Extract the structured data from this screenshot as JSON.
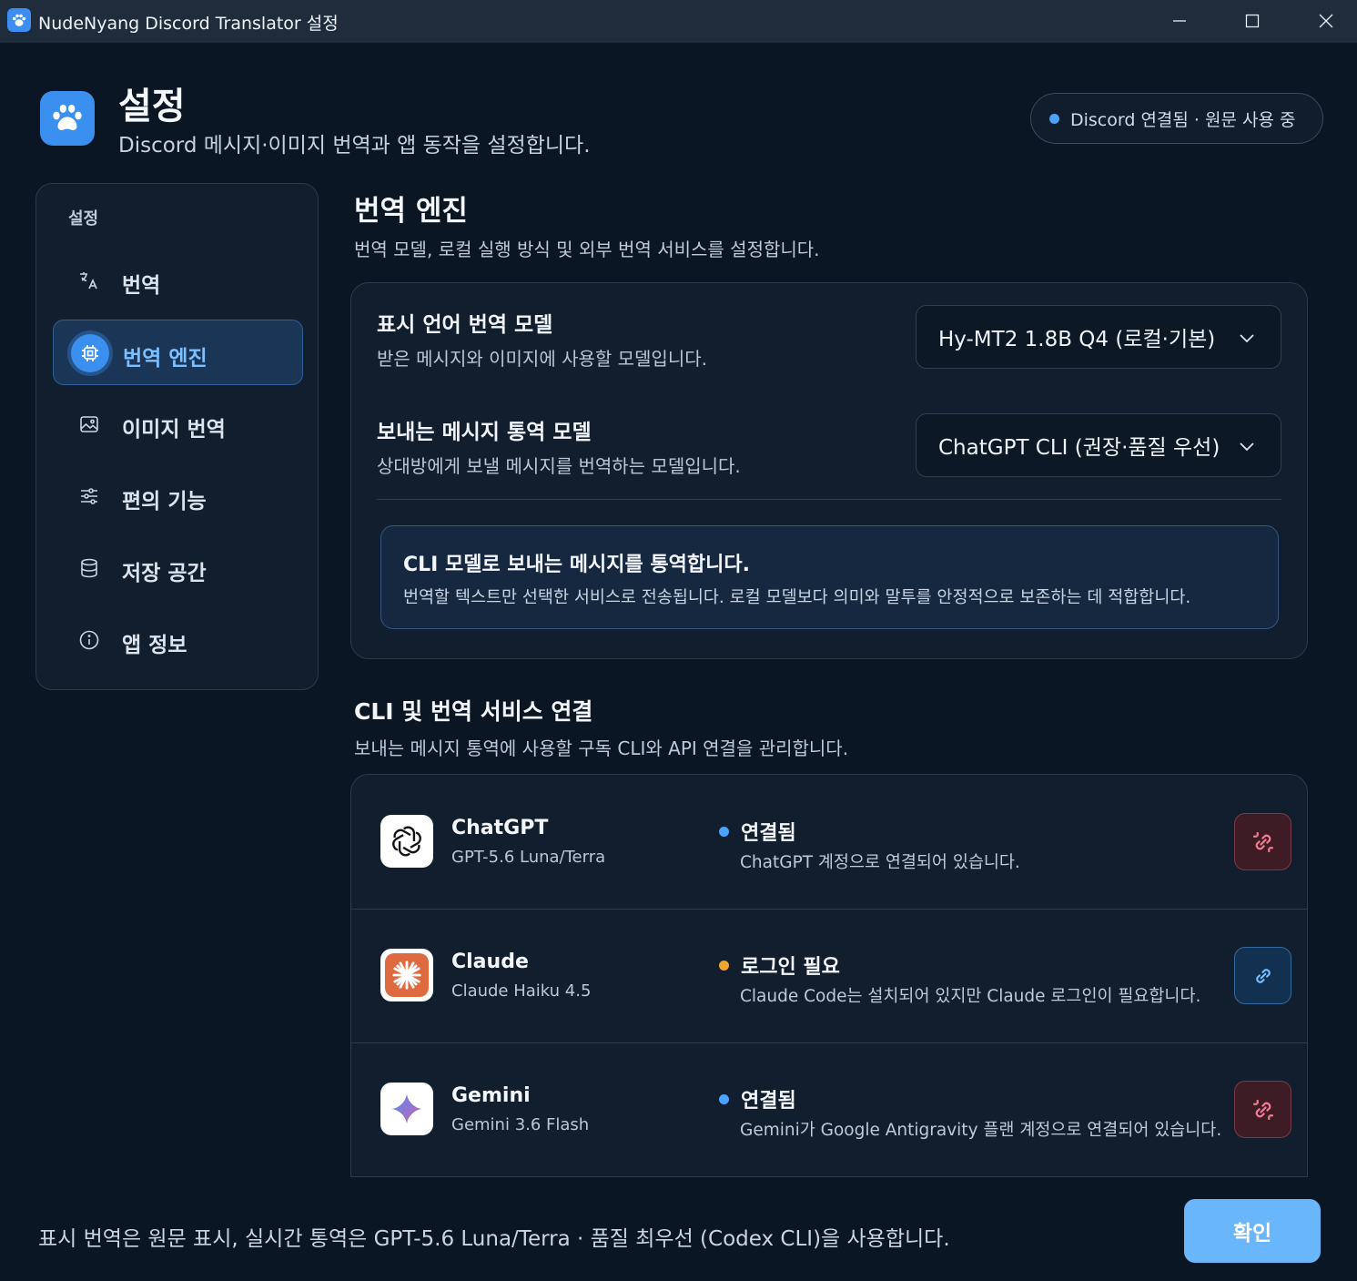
{
  "window": {
    "title": "NudeNyang Discord Translator 설정",
    "icon": "paw-icon"
  },
  "header": {
    "title": "설정",
    "subtitle": "Discord 메시지·이미지 번역과 앱 동작을 설정합니다.",
    "status": "Discord 연결됨 · 원문 사용 중",
    "status_color": "#4aa3ff"
  },
  "sidebar": {
    "heading": "설정",
    "items": [
      {
        "label": "번역",
        "icon": "translate-icon",
        "active": false
      },
      {
        "label": "번역 엔진",
        "icon": "chip-icon",
        "active": true
      },
      {
        "label": "이미지 번역",
        "icon": "image-icon",
        "active": false
      },
      {
        "label": "편의 기능",
        "icon": "sliders-icon",
        "active": false
      },
      {
        "label": "저장 공간",
        "icon": "database-icon",
        "active": false
      },
      {
        "label": "앱 정보",
        "icon": "info-icon",
        "active": false
      }
    ]
  },
  "engine": {
    "title": "번역 엔진",
    "subtitle": "번역 모델, 로컬 실행 방식 및 외부 번역 서비스를 설정합니다.",
    "display_model": {
      "title": "표시 언어 번역 모델",
      "desc": "받은 메시지와 이미지에 사용할 모델입니다.",
      "value": "Hy-MT2 1.8B Q4 (로컬·기본)"
    },
    "send_model": {
      "title": "보내는 메시지 통역 모델",
      "desc": "상대방에게 보낼 메시지를 번역하는 모델입니다.",
      "value": "ChatGPT CLI (권장·품질 우선)"
    },
    "notice": {
      "title": "CLI 모델로 보내는 메시지를 통역합니다.",
      "text": "번역할 텍스트만 선택한 서비스로 전송됩니다. 로컬 모델보다 의미와 말투를 안정적으로 보존하는 데 적합합니다."
    }
  },
  "services": {
    "title": "CLI 및 번역 서비스 연결",
    "subtitle": "보내는 메시지 통역에 사용할 구독 CLI와 API 연결을 관리합니다.",
    "items": [
      {
        "name": "ChatGPT",
        "model": "GPT-5.6 Luna/Terra",
        "status": "연결됨",
        "status_color": "#4aa3ff",
        "desc": "ChatGPT 계정으로 연결되어 있습니다.",
        "action_icon": "unlink-icon"
      },
      {
        "name": "Claude",
        "model": "Claude Haiku 4.5",
        "status": "로그인 필요",
        "status_color": "#f0a531",
        "desc": "Claude Code는 설치되어 있지만 Claude 로그인이 필요합니다.",
        "action_icon": "link-icon"
      },
      {
        "name": "Gemini",
        "model": "Gemini 3.6 Flash",
        "status": "연결됨",
        "status_color": "#4aa3ff",
        "desc": "Gemini가 Google Antigravity 플랜 계정으로 연결되어 있습니다.",
        "action_icon": "unlink-icon"
      }
    ]
  },
  "footer": {
    "summary": "표시 번역은 원문 표시, 실시간 통역은 GPT-5.6 Luna/Terra · 품질 최우선 (Codex CLI)을 사용합니다.",
    "confirm_label": "확인"
  }
}
